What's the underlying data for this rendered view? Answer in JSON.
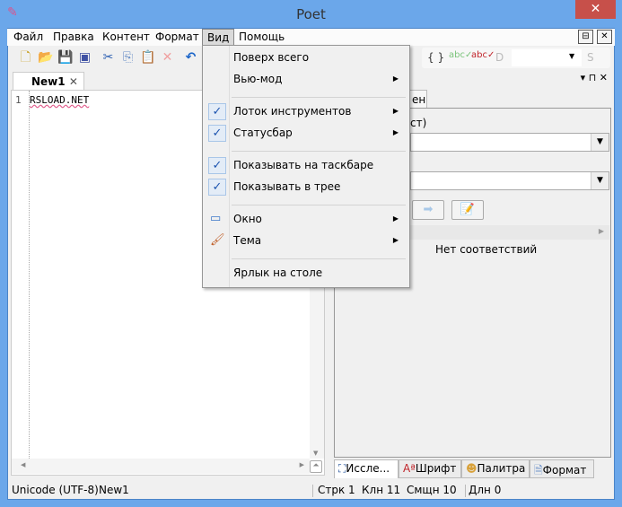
{
  "window": {
    "title": "Poet",
    "close": "✕"
  },
  "menubar": {
    "items": [
      "Файл",
      "Правка",
      "Контент",
      "Формат",
      "Вид",
      "Помощь"
    ],
    "pin": "⊟",
    "close": "✕"
  },
  "editor": {
    "tab": "New1",
    "tab_close": "✕",
    "line_number": "1",
    "text": "RSLOAD.NET"
  },
  "toolbar2": {
    "braces": "{ }",
    "d": "D",
    "s": "S"
  },
  "right_panel": {
    "tab": "ена",
    "label1": "ст)",
    "no_match": "Нет соответствий",
    "header_icons": "▾ ⊓ ✕",
    "bottom_tabs": [
      "Иссле...",
      "Шрифт",
      "Палитра",
      "Формат"
    ]
  },
  "view_menu": {
    "items": [
      {
        "label": "Поверх всего",
        "checked": false,
        "submenu": false
      },
      {
        "label": "Вью-мод",
        "checked": false,
        "submenu": true
      },
      {
        "label": "Лоток инструментов",
        "checked": true,
        "submenu": true
      },
      {
        "label": "Статусбар",
        "checked": true,
        "submenu": true
      },
      {
        "label": "Показывать на таскбаре",
        "checked": true,
        "submenu": false
      },
      {
        "label": "Показывать в трее",
        "checked": true,
        "submenu": false
      },
      {
        "label": "Окно",
        "icon": "window-icon",
        "submenu": true
      },
      {
        "label": "Тема",
        "icon": "brush-icon",
        "submenu": true
      },
      {
        "label": "Ярлык на столе",
        "submenu": false
      }
    ]
  },
  "status": {
    "encoding": "Unicode (UTF-8)",
    "doc": "New1",
    "line": "Стрк 1",
    "col": "Клн 11",
    "offset": "Смщн 10",
    "length": "Длн 0"
  },
  "colors": {
    "frame": "#6ba7ea",
    "close": "#c7504a",
    "check": "#1e55b0"
  }
}
